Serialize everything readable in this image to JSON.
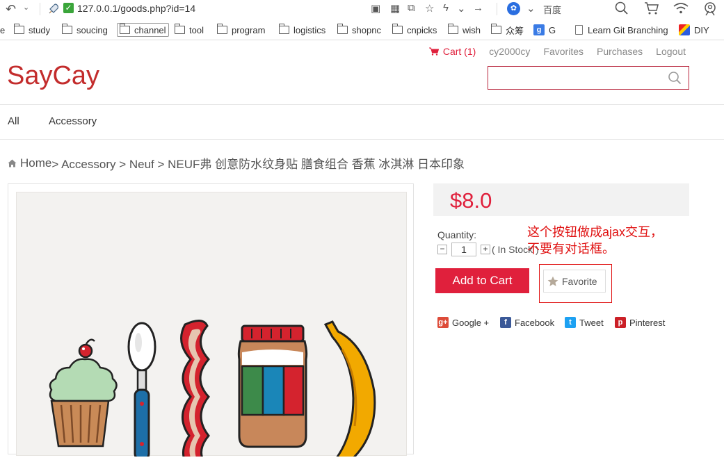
{
  "browser": {
    "url": "127.0.0.1/goods.php?id=14",
    "search_engine": "百度",
    "bookmarks": [
      {
        "label": "e",
        "type": "text"
      },
      {
        "label": "study",
        "type": "folder"
      },
      {
        "label": "soucing",
        "type": "folder"
      },
      {
        "label": "channel",
        "type": "folder"
      },
      {
        "label": "tool",
        "type": "folder"
      },
      {
        "label": "program",
        "type": "folder"
      },
      {
        "label": "logistics",
        "type": "folder"
      },
      {
        "label": "shopnc",
        "type": "folder"
      },
      {
        "label": "cnpicks",
        "type": "folder"
      },
      {
        "label": "wish",
        "type": "folder"
      },
      {
        "label": "众筹",
        "type": "folder"
      },
      {
        "label": "G",
        "type": "google"
      },
      {
        "label": "Learn Git Branching",
        "type": "doc"
      },
      {
        "label": "DIY",
        "type": "diy"
      }
    ]
  },
  "header": {
    "cart_label": "Cart (1)",
    "username": "cy2000cy",
    "favorites": "Favorites",
    "purchases": "Purchases",
    "logout": "Logout",
    "logo": "SayCay"
  },
  "category_nav": [
    "All",
    "Accessory"
  ],
  "breadcrumb": {
    "home": "Home",
    "path": " > Accessory > Neuf > NEUF弗 创意防水纹身贴 膳食组合 香蕉 冰淇淋 日本印象"
  },
  "product": {
    "price": "$8.0",
    "quantity_label": "Quantity:",
    "quantity_value": "1",
    "stock_text": "( In Stock )",
    "add_to_cart": "Add to Cart",
    "favorite": "Favorite"
  },
  "annotation": {
    "line1": "这个按钮做成ajax交互，",
    "line2": "不要有对话框。",
    "color": "#e01010"
  },
  "share": [
    {
      "label": "Google +",
      "icon": "google-plus-icon",
      "color": "#dd4b39"
    },
    {
      "label": "Facebook",
      "icon": "facebook-icon",
      "color": "#3b5998"
    },
    {
      "label": "Tweet",
      "icon": "twitter-icon",
      "color": "#1da1f2"
    },
    {
      "label": "Pinterest",
      "icon": "pinterest-icon",
      "color": "#cb2027"
    }
  ],
  "colors": {
    "brand": "#c32c2c",
    "accent": "#e0203c"
  }
}
